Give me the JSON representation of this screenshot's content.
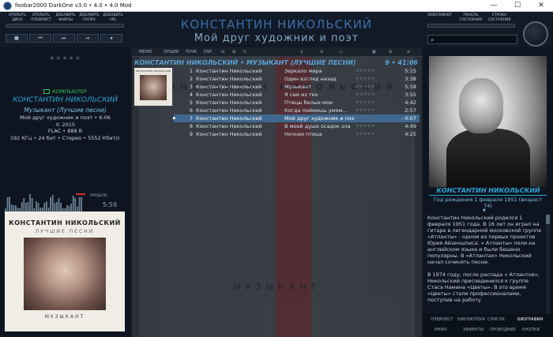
{
  "window": {
    "title": "foobar2000 DarkOne v3.0 • 4.0 • 4.0 Mod",
    "controls": [
      "—",
      "☐",
      "✕"
    ]
  },
  "top_buttons_left": [
    [
      "ОТКРЫТЬ",
      "ДИСК"
    ],
    [
      "ОТКРЫТЬ",
      "ПЛЕЙЛИСТ"
    ],
    [
      "ДОБАВИТЬ",
      "ФАЙЛЫ"
    ],
    [
      "ДОБАВИТЬ",
      "ПАПКУ"
    ],
    [
      "ДОБАВИТЬ",
      "URL"
    ]
  ],
  "top_buttons_right": [
    [
      "ЭКВАЛАЙЗЕР",
      ""
    ],
    [
      "ПАНЕЛЬ",
      "СОСТОЯНИЯ"
    ],
    [
      "СТРОКА",
      "СОСТОЯНИЯ"
    ]
  ],
  "transport": [
    "■",
    "⏮",
    "⏭",
    "⏯",
    "⏹"
  ],
  "header": {
    "artist": "КОНСТАНТИН НИКОЛЬСКИЙ",
    "title": "Мой друг художник и поэт"
  },
  "volume_label": "ГРОМКОСТЬ",
  "left": {
    "stars": "★★★★★",
    "source": "КОМПЬЮТЕР",
    "artist": "КОНСТАНТИН НИКОЛЬСКИЙ",
    "album": "Музыкант (Лучшие песни)",
    "track_time": "Мой друг художник и поэт • 6:06",
    "year": "© 2015",
    "format": "FLAC • 888 В",
    "tech": "192 КГц • 24 бит • Стерео • 5552 Кбит/с",
    "remain_label": "ПРОШЛО",
    "time": "5:59",
    "cover": {
      "artist": "КОНСТАНТИН НИКОЛЬСКИЙ",
      "subtitle": "ЛУЧШИЕ ПЕСНИ",
      "word": "МУЗЫКАНТ"
    }
  },
  "center": {
    "menu": [
      "МЕНЮ",
      "ОПЦИИ",
      "ТОЧК",
      "DSP"
    ],
    "group_header": "КОНСТАНТИН НИКОЛЬСКИЙ • МУЗЫКАНТ (ЛУЧШИЕ ПЕСНИ)",
    "group_count": "9 • 41:06",
    "bg_artist": "КОНСТАНТИН НИКОЛЬСКИЙ",
    "bg_word": "МУЗЫКАНТ",
    "playing_index": 6,
    "tracks": [
      {
        "no": "1",
        "artist": "Константин Никольский",
        "title": "Зеркало мира",
        "stars": "★★★★★",
        "dur": "5:15"
      },
      {
        "no": "2",
        "artist": "Константин Никольский",
        "title": "Один взгляд назад",
        "stars": "★★★★★",
        "dur": "3:38"
      },
      {
        "no": "3",
        "artist": "Константин Никольский",
        "title": "Музыкант",
        "stars": "★★★★★",
        "dur": "5:18"
      },
      {
        "no": "4",
        "artist": "Константин Никольский",
        "title": "Я сам из тех",
        "stars": "★★★★★",
        "dur": "3:55"
      },
      {
        "no": "5",
        "artist": "Константин Никольский",
        "title": "Птицы белые мои",
        "stars": "★★★★★",
        "dur": "4:42"
      },
      {
        "no": "6",
        "artist": "Константин Никольский",
        "title": "Когда поймешь умом...",
        "stars": "★★★★★",
        "dur": "2:57"
      },
      {
        "no": "7",
        "artist": "Константин Никольский",
        "title": "Мой друг художник и поэт",
        "stars": "★★★★★",
        "dur": "- 0:07"
      },
      {
        "no": "8",
        "artist": "Константин Никольский",
        "title": "В моей душе осадок зла",
        "stars": "★★★★★",
        "dur": "4:49"
      },
      {
        "no": "9",
        "artist": "Константин Никольский",
        "title": "Ночная птица",
        "stars": "★★★★★",
        "dur": "4:25"
      }
    ]
  },
  "right": {
    "artist": "КОНСТАНТИН НИКОЛЬСКИЙ",
    "birth": "Год рождения 1 февраля 1951 (возраст 74)",
    "bio": [
      "Константин Никольский родился 1 февраля 1951 года. В 16 лет он играл на гитаре в легендарной московской группе «Атланты» - одном из первых проектов Юрия Айзеншписа. « Атланты» пели на английском языке и были бешено популярны. В «Атлантах» Никольский начал сочинять песни.",
      "В 1974 году, после распада « Атлантов», Никольский присоединился к группе Стаса Намина «Цветы». В это время «Цветы» стали профессионалами, поступив на работу"
    ],
    "tabs_row1": [
      "ПЛЕЙЛИСТ",
      "БИБЛИОТЕКА",
      "СПИСОК",
      "БИОГРАФИЯ"
    ],
    "tabs_row2": [
      "ИНФО",
      "ЭФФЕКТЫ",
      "ПРОВОДНИК",
      "КНОПКИ"
    ]
  }
}
